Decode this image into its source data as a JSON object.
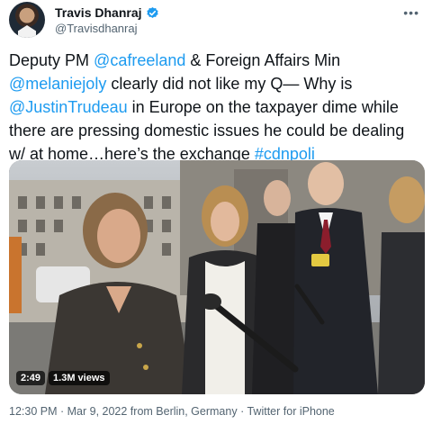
{
  "author": {
    "display_name": "Travis Dhanraj",
    "handle": "@Travisdhanraj"
  },
  "tweet": {
    "segments": [
      {
        "text": "Deputy PM ",
        "type": "text"
      },
      {
        "text": "@cafreeland",
        "type": "mention"
      },
      {
        "text": " & Foreign Affairs Min ",
        "type": "text"
      },
      {
        "text": "@melaniejoly",
        "type": "mention"
      },
      {
        "text": " clearly did not like my Q— Why is ",
        "type": "text"
      },
      {
        "text": "@JustinTrudeau",
        "type": "mention"
      },
      {
        "text": " in Europe on the taxpayer dime while there are pressing domestic issues he could be dealing w/ at home…here’s the exchange ",
        "type": "text"
      },
      {
        "text": "#cdnpoli",
        "type": "hashtag"
      }
    ]
  },
  "media": {
    "duration": "2:49",
    "views": "1.3M views"
  },
  "meta": {
    "time": "12:30 PM",
    "date": "Mar 9, 2022 from Berlin, Germany",
    "source": "Twitter for iPhone",
    "separator": " · "
  },
  "colors": {
    "link": "#1d9bf0",
    "text": "#0f1419",
    "secondary": "#536471",
    "verified": "#1d9bf0"
  },
  "icons": [
    "verified-badge-icon",
    "more-options-icon"
  ]
}
